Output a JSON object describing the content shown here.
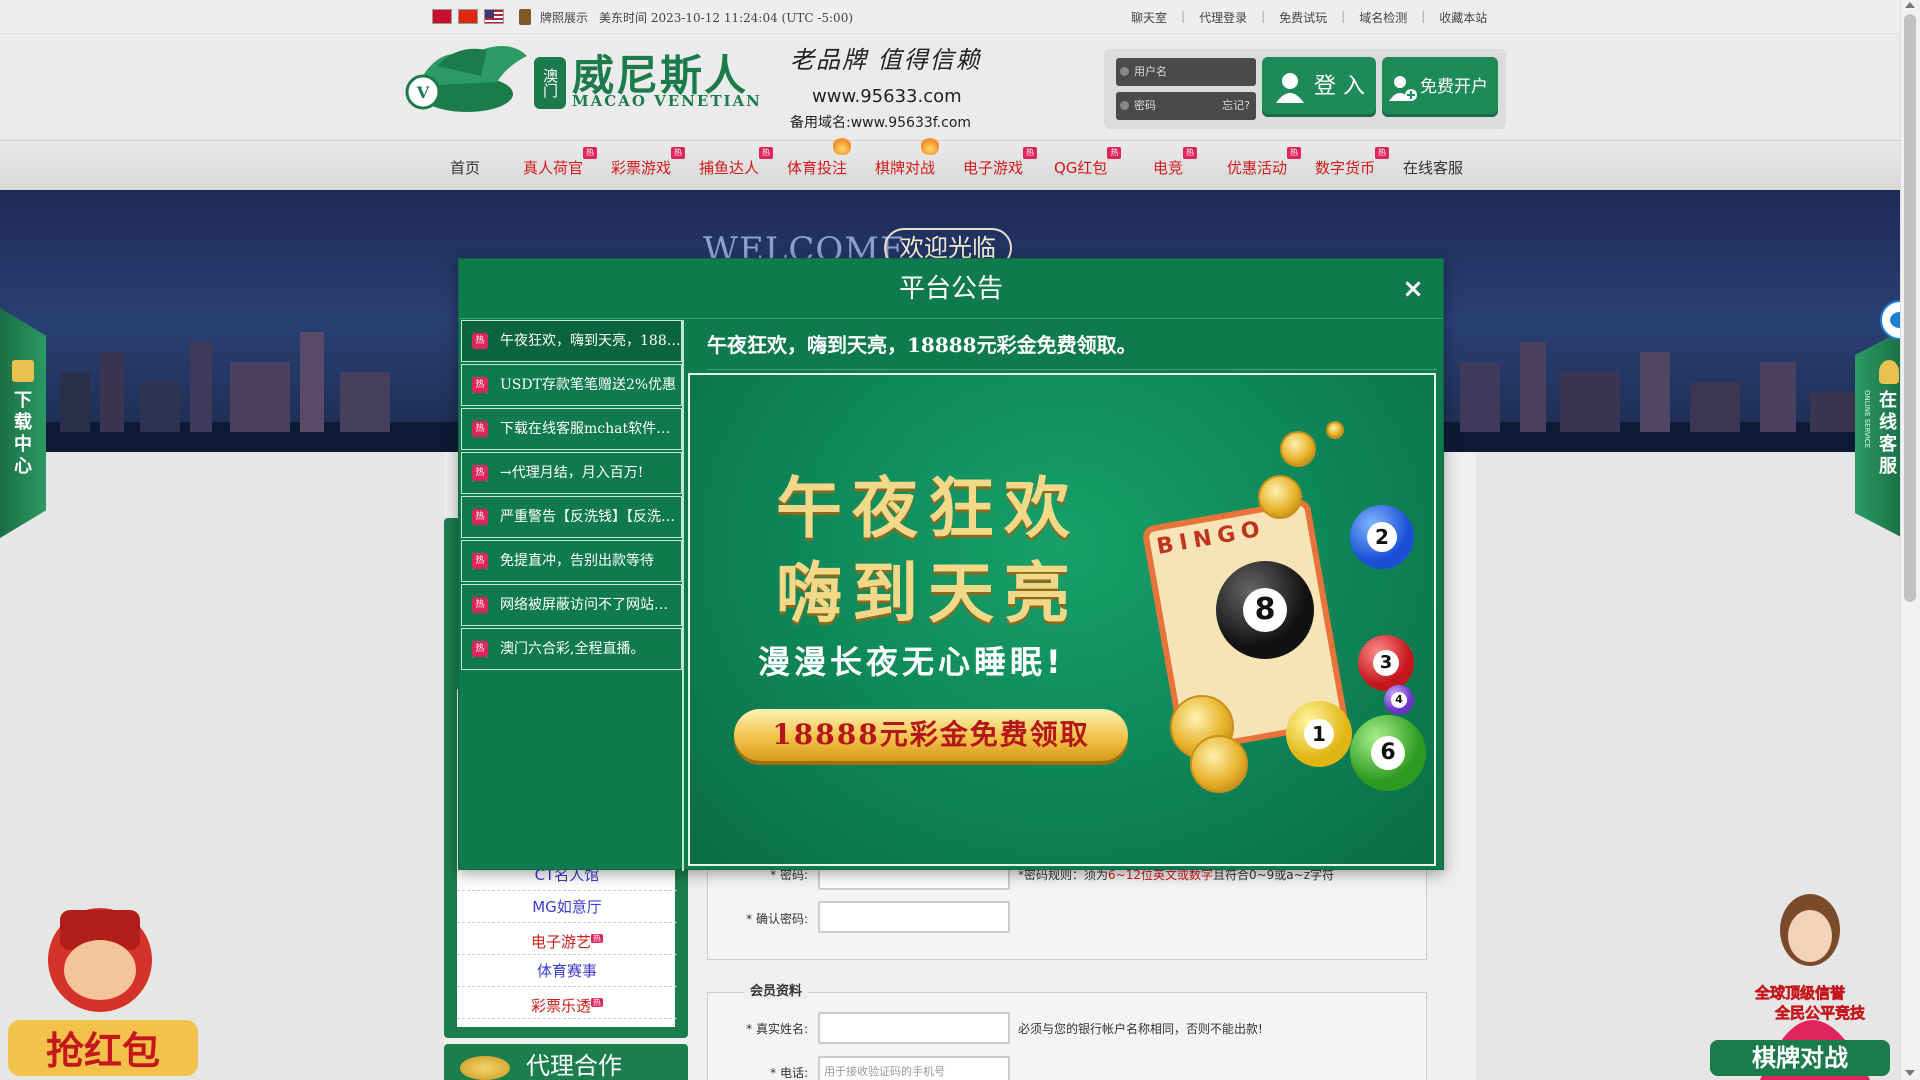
{
  "topbar": {
    "license": "牌照展示",
    "time": "美东时间 2023-10-12 11:24:04 (UTC -5:00)",
    "links": [
      "聊天室",
      "代理登录",
      "免费试玩",
      "域名检测",
      "收藏本站"
    ]
  },
  "header": {
    "logo_cn": "威尼斯人",
    "logo_macau": "澳门",
    "logo_en": "MACAO VENETIAN",
    "slogan": "老品牌 值得信赖",
    "domain": "www.95633.com",
    "backup_domain": "备用域名:www.95633f.com"
  },
  "login": {
    "username_placeholder": "用户名",
    "password_placeholder": "密码",
    "forgot": "忘记?",
    "login_label": "登 入",
    "register_label": "免费开户"
  },
  "nav": {
    "items": [
      {
        "label": "首页",
        "hot": false
      },
      {
        "label": "真人荷官",
        "hot": true
      },
      {
        "label": "彩票游戏",
        "hot": true
      },
      {
        "label": "捕鱼达人",
        "hot": true
      },
      {
        "label": "体育投注",
        "hot": true
      },
      {
        "label": "棋牌对战",
        "hot": true
      },
      {
        "label": "电子游戏",
        "hot": true
      },
      {
        "label": "QG红包",
        "hot": true
      },
      {
        "label": "电竞",
        "hot": true
      },
      {
        "label": "优惠活动",
        "hot": true
      },
      {
        "label": "数字货币",
        "hot": true
      },
      {
        "label": "在线客服",
        "hot": false
      }
    ],
    "hot_badge": "热"
  },
  "banner": {
    "welcome_en": "WELCOME",
    "welcome_cn": "欢迎光临"
  },
  "sidebar": {
    "links": [
      "CT名人馆",
      "MG如意厅",
      "电子游艺",
      "体育赛事",
      "彩票乐透"
    ],
    "agent_title": "代理合作"
  },
  "form": {
    "password_label": "* 密码:",
    "password_hint_pre": "*密码规则：须为",
    "password_hint_red": "6~12位英文或数字",
    "password_hint_post": "且符合0~9或a~z字符",
    "confirm_label": "* 确认密码:",
    "member_legend": "会员资料",
    "realname_label": "* 真实姓名:",
    "realname_hint": "必须与您的银行帐户名称相同，否则不能出款!",
    "phone_label": "* 电话:",
    "phone_placeholder": "用于接收验证码的手机号"
  },
  "float": {
    "left_label": "下载中心",
    "right_label": "在线客服",
    "right_sub": "ONLINE SERVICE"
  },
  "modal": {
    "title": "平台公告",
    "close": "×",
    "announcements": [
      "午夜狂欢，嗨到天亮，18888元彩金免费领取。",
      "USDT存款笔笔赠送2%优惠",
      "下载在线客服mchat软件，随时随地联系客服",
      "→代理月结，月入百万!",
      "严重警告【反洗钱】【反洗钱】",
      "免提直冲，告别出款等待",
      "网络被屏蔽访问不了网站怎么办",
      "澳门六合彩,全程直播。"
    ],
    "headline": "午夜狂欢，嗨到天亮，18888元彩金免费领取。",
    "promo": {
      "line1": "午夜狂欢",
      "line2": "嗨到天亮",
      "sub": "漫漫长夜无心睡眠!",
      "button": "18888元彩金免费领取",
      "bingo": "BINGO"
    }
  },
  "promos": {
    "left": "抢红包",
    "right_top": "全球顶级信誉",
    "right_mid": "全民公平竞技",
    "right_bottom": "棋牌对战"
  },
  "colors": {
    "brand_green": "#1b7b4a",
    "modal_green": "#0f7a4e",
    "hot_red": "#e0245e",
    "nav_red": "#d21a1a"
  }
}
